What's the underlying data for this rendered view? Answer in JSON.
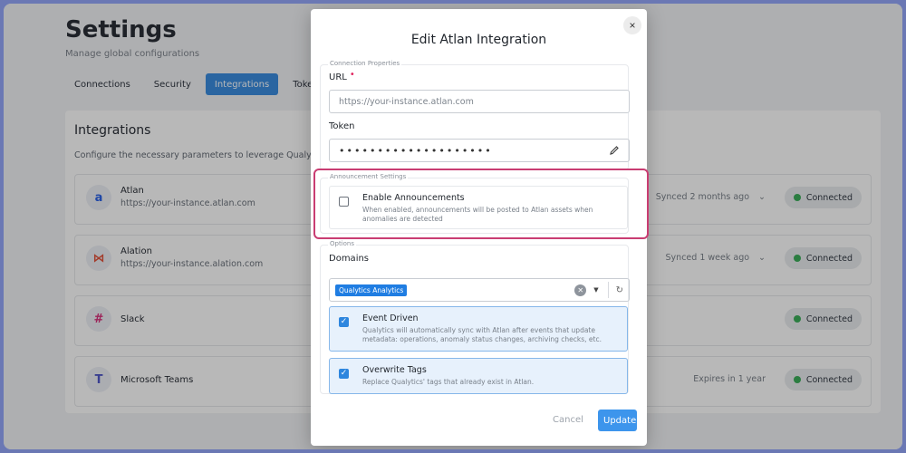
{
  "background": {
    "title": "Settings",
    "subtitle": "Manage global configurations",
    "tabs": [
      {
        "label": "Connections"
      },
      {
        "label": "Security"
      },
      {
        "label": "Integrations",
        "active": true
      },
      {
        "label": "Tokens"
      }
    ],
    "panel": {
      "title": "Integrations",
      "description": "Configure the necessary parameters to leverage Qualytics wi",
      "integrations": [
        {
          "name": "Atlan",
          "url": "https://your-instance.atlan.com",
          "sync": "Synced 2 months ago",
          "status": "Connected",
          "logo": "a"
        },
        {
          "name": "Alation",
          "url": "https://your-instance.alation.com",
          "sync": "Synced 1 week ago",
          "status": "Connected",
          "logo": "⋈"
        },
        {
          "name": "Slack",
          "url": "",
          "sync": "",
          "status": "Connected",
          "logo": "#"
        },
        {
          "name": "Microsoft Teams",
          "url": "",
          "sync": "Expires in 1 year",
          "status": "Connected",
          "logo": "T"
        }
      ]
    }
  },
  "modal": {
    "title": "Edit Atlan Integration",
    "close_icon": "×",
    "connection": {
      "legend": "Connection Properties",
      "url_label": "URL",
      "required_mark": "•",
      "url_placeholder": "https://your-instance.atlan.com",
      "token_label": "Token",
      "token_mask": "••••••••••••••••••••"
    },
    "announcement": {
      "legend": "Announcement Settings",
      "title": "Enable Announcements",
      "description": "When enabled, announcements will be posted to Atlan assets when anomalies are detected",
      "checked": false
    },
    "options": {
      "legend": "Options",
      "domains_label": "Domains",
      "selected_domain": "Qualytics Analytics",
      "event_driven": {
        "title": "Event Driven",
        "description": "Qualytics will automatically sync with Atlan after events that update metadata: operations, anomaly status changes, archiving checks, etc.",
        "checked": true
      },
      "overwrite_tags": {
        "title": "Overwrite Tags",
        "description": "Replace Qualytics' tags that already exist in Atlan.",
        "checked": true
      }
    },
    "cancel_label": "Cancel",
    "update_label": "Update"
  },
  "colors": {
    "accent": "#3d95ec",
    "highlight": "#c93d72",
    "connected_dot": "#3cae5a"
  }
}
